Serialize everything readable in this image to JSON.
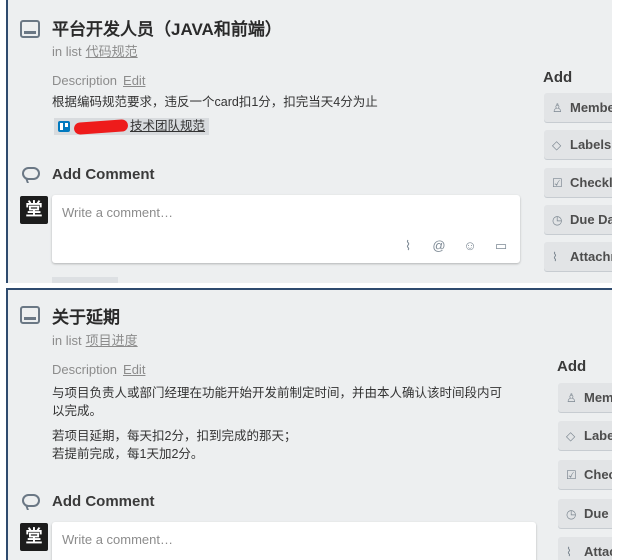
{
  "card1": {
    "title": "平台开发人员（JAVA和前端）",
    "in_list_prefix": "in list",
    "list_name": "代码规范",
    "description_label": "Description",
    "edit_label": "Edit",
    "description_text": "根据编码规范要求，违反一个card扣1分，扣完当天4分为止",
    "attachment_text": "技术团队规范",
    "comment_section": "Add Comment",
    "comment_placeholder": "Write a comment…",
    "avatar_glyph": "堂",
    "add_title": "Add",
    "sidebar": [
      {
        "icon": "member-icon",
        "glyph": "♙",
        "label": "Members"
      },
      {
        "icon": "label-icon",
        "glyph": "◇",
        "label": "Labels"
      },
      {
        "icon": "checklist-icon",
        "glyph": "☑",
        "label": "Checklist"
      },
      {
        "icon": "clock-icon",
        "glyph": "◷",
        "label": "Due Date"
      },
      {
        "icon": "paperclip-icon",
        "glyph": "⌇",
        "label": "Attachment"
      }
    ]
  },
  "card2": {
    "title": "关于延期",
    "in_list_prefix": "in list",
    "list_name": "项目进度",
    "description_label": "Description",
    "edit_label": "Edit",
    "description_lines": [
      "与项目负责人或部门经理在功能开始开发前制定时间，并由本人确认该时间段内可",
      "以完成。",
      "若项目延期，每天扣2分，扣到完成的那天；",
      "若提前完成，每1天加2分。"
    ],
    "comment_section": "Add Comment",
    "comment_placeholder": "Write a comment…",
    "avatar_glyph": "堂",
    "add_title": "Add",
    "sidebar": [
      {
        "icon": "member-icon",
        "glyph": "♙",
        "label": "Members"
      },
      {
        "icon": "label-icon",
        "glyph": "◇",
        "label": "Labels"
      },
      {
        "icon": "checklist-icon",
        "glyph": "☑",
        "label": "Checklist"
      },
      {
        "icon": "clock-icon",
        "glyph": "◷",
        "label": "Due Date"
      },
      {
        "icon": "paperclip-icon",
        "glyph": "⌇",
        "label": "Attachment"
      }
    ]
  },
  "comment_toolbar": [
    {
      "icon": "attach-icon",
      "glyph": "⌇"
    },
    {
      "icon": "mention-icon",
      "glyph": "@"
    },
    {
      "icon": "emoji-icon",
      "glyph": "☺"
    },
    {
      "icon": "card-icon",
      "glyph": "▭"
    }
  ],
  "colors": {
    "card_bg": "#edeff0",
    "border": "#2f4b6e",
    "attachment_bg": "#d8dbde"
  }
}
